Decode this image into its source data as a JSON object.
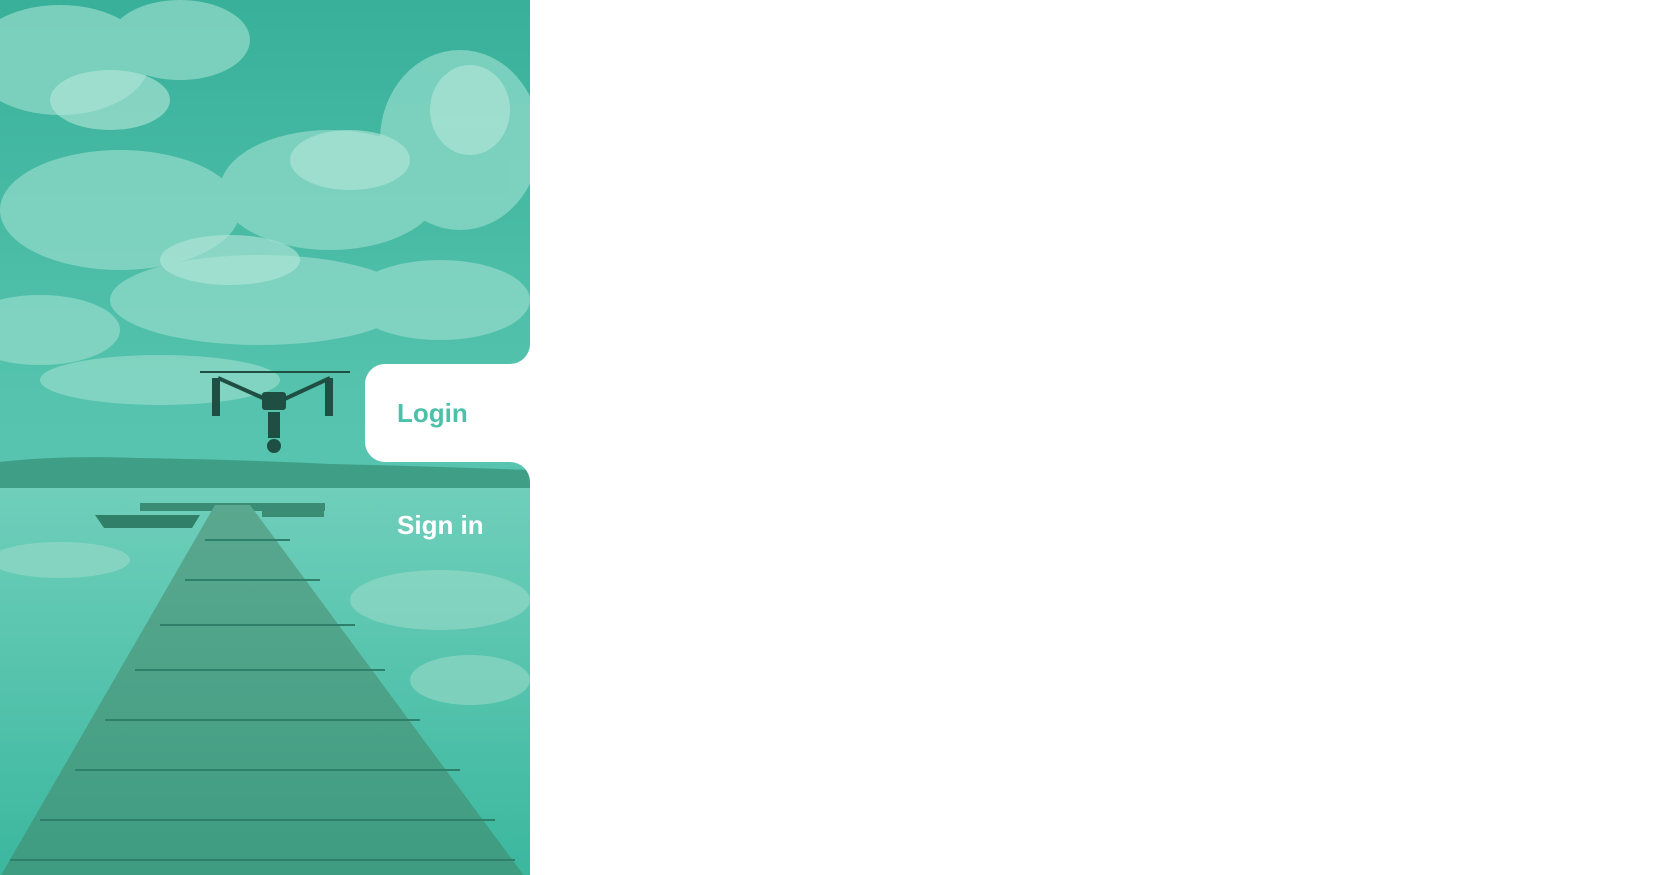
{
  "tabs": {
    "login_label": "Login",
    "signin_label": "Sign in"
  },
  "theme": {
    "accent": "#4cc1a9",
    "panel_tint": "#45bfa7"
  }
}
